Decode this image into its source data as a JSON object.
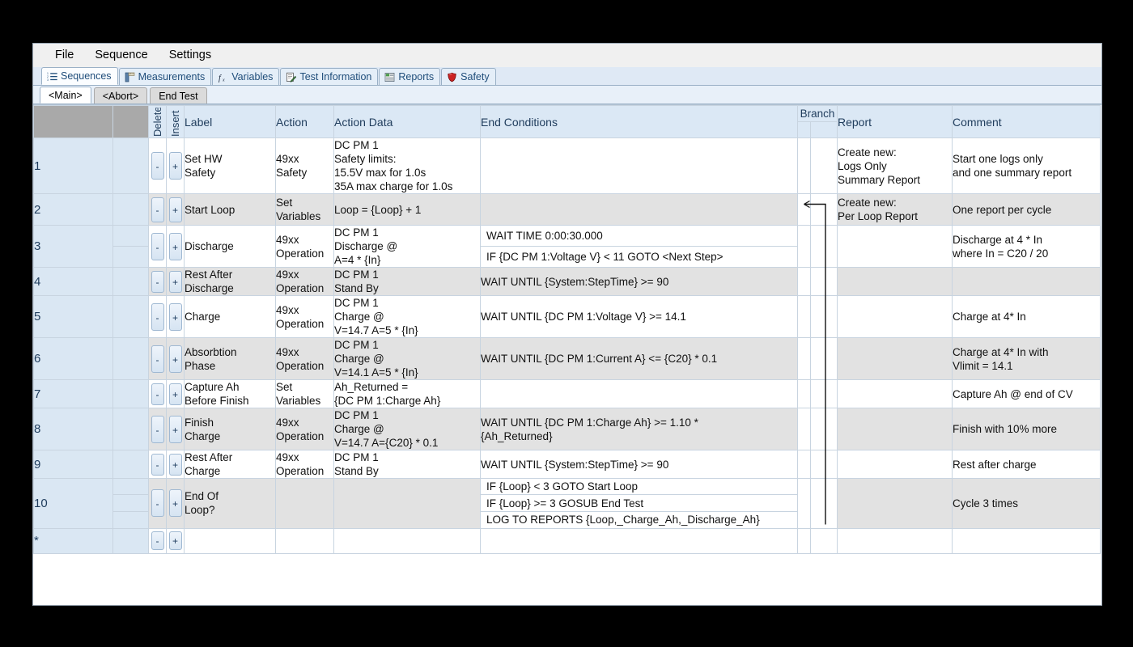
{
  "menu": {
    "items": [
      "File",
      "Sequence",
      "Settings"
    ]
  },
  "tabs": [
    {
      "label": "Sequences",
      "icon": "list-icon",
      "active": true
    },
    {
      "label": "Measurements",
      "icon": "ruler-icon",
      "active": false
    },
    {
      "label": "Variables",
      "icon": "function-icon",
      "active": false
    },
    {
      "label": "Test Information",
      "icon": "clipboard-icon",
      "active": false
    },
    {
      "label": "Reports",
      "icon": "report-icon",
      "active": false
    },
    {
      "label": "Safety",
      "icon": "shield-icon",
      "active": false
    }
  ],
  "subtabs": [
    {
      "label": "<Main>",
      "active": true
    },
    {
      "label": "<Abort>",
      "active": false
    },
    {
      "label": "End Test",
      "active": false
    }
  ],
  "grid": {
    "headers": {
      "delete": "Delete",
      "insert": "Insert",
      "label": "Label",
      "action": "Action",
      "action_data": "Action Data",
      "end_conditions": "End Conditions",
      "branch": "Branch",
      "report": "Report",
      "comment": "Comment"
    },
    "buttons": {
      "delete": "-",
      "insert": "+"
    },
    "rows": [
      {
        "num": "1",
        "label": "Set HW\nSafety",
        "action": "49xx\nSafety",
        "action_data": "DC PM 1\nSafety limits:\n15.5V max for 1.0s\n35A max charge for 1.0s",
        "end_conditions": [],
        "report": "Create new:\n    Logs Only\n    Summary Report",
        "comment": "Start one logs only\nand one summary report",
        "alt": false
      },
      {
        "num": "2",
        "label": "Start Loop",
        "action": "Set\nVariables",
        "action_data": "Loop = {Loop} + 1",
        "end_conditions": [],
        "report": "Create new:\nPer Loop Report",
        "comment": "One report per cycle",
        "alt": true
      },
      {
        "num": "3",
        "label": "Discharge",
        "action": "49xx\nOperation",
        "action_data": "DC PM 1\nDischarge @\nA=4 * {In}",
        "end_conditions": [
          "WAIT TIME 0:00:30.000",
          "IF {DC PM 1:Voltage V} < 11 GOTO <Next Step>"
        ],
        "report": "",
        "comment": "Discharge at 4 * In\nwhere In = C20 / 20",
        "alt": false
      },
      {
        "num": "4",
        "label": "Rest After\nDischarge",
        "action": "49xx\nOperation",
        "action_data": "DC PM 1\nStand By",
        "end_conditions": [
          "WAIT UNTIL {System:StepTime} >= 90"
        ],
        "report": "",
        "comment": "",
        "alt": true
      },
      {
        "num": "5",
        "label": "Charge",
        "action": "49xx\nOperation",
        "action_data": "DC PM 1\nCharge @\nV=14.7    A=5 * {In}",
        "end_conditions": [
          "WAIT UNTIL {DC PM 1:Voltage V} >= 14.1"
        ],
        "report": "",
        "comment": "Charge at 4* In",
        "alt": false
      },
      {
        "num": "6",
        "label": "Absorbtion\nPhase",
        "action": "49xx\nOperation",
        "action_data": "DC PM 1\nCharge @\nV=14.1    A=5 * {In}",
        "end_conditions": [
          "WAIT UNTIL {DC PM 1:Current A} <= {C20} * 0.1"
        ],
        "report": "",
        "comment": "Charge at 4* In with\nVlimit = 14.1",
        "alt": true
      },
      {
        "num": "7",
        "label": "Capture Ah\nBefore Finish",
        "action": "Set\nVariables",
        "action_data": "Ah_Returned =\n{DC PM 1:Charge Ah}",
        "end_conditions": [],
        "report": "",
        "comment": "Capture Ah @ end of CV",
        "alt": false
      },
      {
        "num": "8",
        "label": "Finish\nCharge",
        "action": "49xx\nOperation",
        "action_data": "DC PM 1\nCharge @\nV=14.7    A={C20} * 0.1",
        "end_conditions": [
          "WAIT UNTIL {DC PM 1:Charge Ah} >= 1.10 *\n{Ah_Returned}"
        ],
        "report": "",
        "comment": "Finish with 10% more",
        "alt": true
      },
      {
        "num": "9",
        "label": "Rest After\nCharge",
        "action": "49xx\nOperation",
        "action_data": "DC PM 1\nStand By",
        "end_conditions": [
          "WAIT UNTIL {System:StepTime} >= 90"
        ],
        "report": "",
        "comment": "Rest after charge",
        "alt": false
      },
      {
        "num": "10",
        "label": "End Of\nLoop?",
        "action": "",
        "action_data": "",
        "end_conditions": [
          "IF {Loop} < 3 GOTO Start Loop",
          "IF {Loop} >= 3 GOSUB End Test",
          "LOG TO REPORTS {Loop,_Charge_Ah,_Discharge_Ah}"
        ],
        "report": "",
        "comment": "Cycle 3 times",
        "alt": true
      },
      {
        "num": "*",
        "label": "",
        "action": "",
        "action_data": "",
        "end_conditions": [],
        "report": "",
        "comment": "",
        "alt": false
      }
    ],
    "branch_arrow": {
      "from_row": "10",
      "to_row": "2",
      "description": "loop-back-arrow"
    }
  },
  "colors": {
    "header_bg": "#dbe8f5",
    "header_text": "#1f3c5c",
    "rownum_bg": "#dae7f3",
    "alt_row_bg": "#e2e2e2",
    "tab_active_bg": "#fbfdff",
    "tabstrip_bg": "#dfe9f5",
    "accent": "#1f4d7a"
  }
}
